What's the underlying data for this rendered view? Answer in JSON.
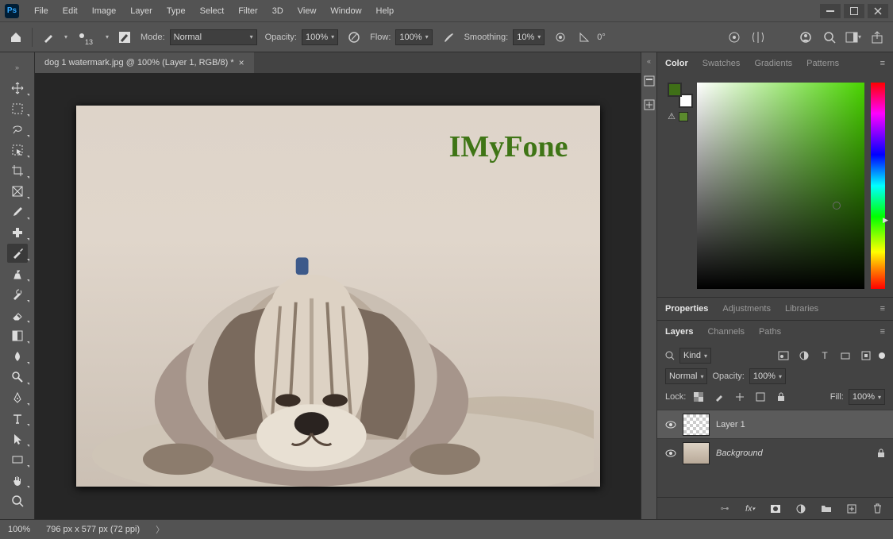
{
  "menu": [
    "File",
    "Edit",
    "Image",
    "Layer",
    "Type",
    "Select",
    "Filter",
    "3D",
    "View",
    "Window",
    "Help"
  ],
  "optbar": {
    "brush_size": "13",
    "mode_label": "Mode:",
    "mode_value": "Normal",
    "opacity_label": "Opacity:",
    "opacity_value": "100%",
    "flow_label": "Flow:",
    "flow_value": "100%",
    "smoothing_label": "Smoothing:",
    "smoothing_value": "10%",
    "angle_label": "0°"
  },
  "document": {
    "tab_title": "dog 1 watermark.jpg @ 100% (Layer 1, RGB/8) *",
    "watermark_text": "IMyFone"
  },
  "panels": {
    "color_tabs": [
      "Color",
      "Swatches",
      "Gradients",
      "Patterns"
    ],
    "mid_tabs": [
      "Properties",
      "Adjustments",
      "Libraries"
    ],
    "layer_tabs": [
      "Layers",
      "Channels",
      "Paths"
    ]
  },
  "layers": {
    "filter_label": "Kind",
    "blend_mode": "Normal",
    "opacity_label": "Opacity:",
    "opacity_value": "100%",
    "lock_label": "Lock:",
    "fill_label": "Fill:",
    "fill_value": "100%",
    "list": [
      {
        "name": "Layer 1",
        "bg": false,
        "sel": true
      },
      {
        "name": "Background",
        "bg": true,
        "sel": false
      }
    ]
  },
  "status": {
    "zoom": "100%",
    "info": "796 px x 577 px (72 ppi)"
  },
  "colors": {
    "foreground": "#3f6f17",
    "background": "#ffffff"
  }
}
